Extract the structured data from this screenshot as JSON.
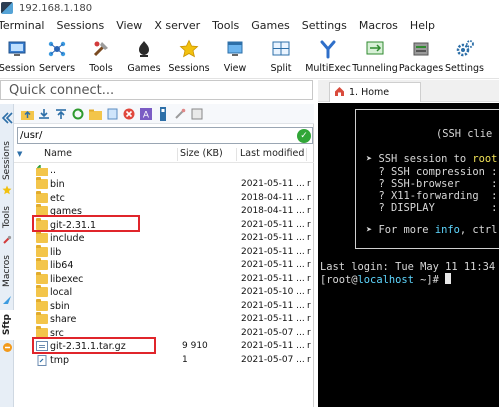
{
  "window": {
    "title": "192.168.1.180"
  },
  "menu": [
    "Terminal",
    "Sessions",
    "View",
    "X server",
    "Tools",
    "Games",
    "Settings",
    "Macros",
    "Help"
  ],
  "toolbar": [
    {
      "label": "Session",
      "icon": "session-icon"
    },
    {
      "label": "Servers",
      "icon": "servers-icon"
    },
    {
      "label": "Tools",
      "icon": "tools-icon"
    },
    {
      "label": "Games",
      "icon": "games-icon"
    },
    {
      "label": "Sessions",
      "icon": "star-icon"
    },
    {
      "label": "View",
      "icon": "view-icon"
    },
    {
      "label": "Split",
      "icon": "split-icon"
    },
    {
      "label": "MultiExec",
      "icon": "multiexec-icon"
    },
    {
      "label": "Tunneling",
      "icon": "tunneling-icon"
    },
    {
      "label": "Packages",
      "icon": "packages-icon"
    },
    {
      "label": "Settings",
      "icon": "settings-icon"
    }
  ],
  "quick_connect": {
    "placeholder": "Quick connect..."
  },
  "tabs": {
    "home": "1. Home"
  },
  "side_tabs": [
    "Sessions",
    "Tools",
    "Macros",
    "Sftp"
  ],
  "sftp": {
    "path": "/usr/",
    "columns": {
      "name": "Name",
      "size": "Size (KB)",
      "modified": "Last modified"
    },
    "files": [
      {
        "name": "..",
        "size": "",
        "date": "",
        "type": "up",
        "owner": ""
      },
      {
        "name": "bin",
        "size": "",
        "date": "2021-05-11 ...",
        "type": "folder",
        "owner": "r"
      },
      {
        "name": "etc",
        "size": "",
        "date": "2018-04-11 ...",
        "type": "folder",
        "owner": "r"
      },
      {
        "name": "games",
        "size": "",
        "date": "2018-04-11 ...",
        "type": "folder",
        "owner": "r"
      },
      {
        "name": "git-2.31.1",
        "size": "",
        "date": "2021-05-11 ...",
        "type": "folder",
        "owner": "r"
      },
      {
        "name": "include",
        "size": "",
        "date": "2021-05-11 ...",
        "type": "folder",
        "owner": "r"
      },
      {
        "name": "lib",
        "size": "",
        "date": "2021-05-11 ...",
        "type": "folder",
        "owner": "r"
      },
      {
        "name": "lib64",
        "size": "",
        "date": "2021-05-11 ...",
        "type": "folder",
        "owner": "r"
      },
      {
        "name": "libexec",
        "size": "",
        "date": "2021-05-11 ...",
        "type": "folder",
        "owner": "r"
      },
      {
        "name": "local",
        "size": "",
        "date": "2021-05-10 ...",
        "type": "folder",
        "owner": "r"
      },
      {
        "name": "sbin",
        "size": "",
        "date": "2021-05-11 ...",
        "type": "folder",
        "owner": "r"
      },
      {
        "name": "share",
        "size": "",
        "date": "2021-05-11 ...",
        "type": "folder",
        "owner": "r"
      },
      {
        "name": "src",
        "size": "",
        "date": "2021-05-07 ...",
        "type": "folder",
        "owner": "r"
      },
      {
        "name": "git-2.31.1.tar.gz",
        "size": "9 910",
        "date": "2021-05-11 ...",
        "type": "file",
        "owner": "r"
      },
      {
        "name": "tmp",
        "size": "1",
        "date": "2021-05-07 ...",
        "type": "link",
        "owner": "r"
      }
    ]
  },
  "terminal": {
    "header": "(SSH clie",
    "lines": [
      {
        "prefix": "➤ ",
        "text": "SSH session to ",
        "accent": "root"
      },
      {
        "prefix": "  ? ",
        "text": "SSH compression : ",
        "accent": ""
      },
      {
        "prefix": "  ? ",
        "text": "SSH-browser     : ",
        "accent": ""
      },
      {
        "prefix": "  ? ",
        "text": "X11-forwarding  : ",
        "accent": ""
      },
      {
        "prefix": "  ? ",
        "text": "DISPLAY         : ",
        "accent": ""
      }
    ],
    "more": {
      "prefix": "➤ ",
      "text1": "For more ",
      "accent": "info",
      "text2": ", ctrl"
    },
    "last_login": "Last login: Tue May 11 11:34",
    "prompt_open": "[root@",
    "prompt_host": "localhost",
    "prompt_close": " ~]# "
  },
  "highlight_color": "#e0252b"
}
